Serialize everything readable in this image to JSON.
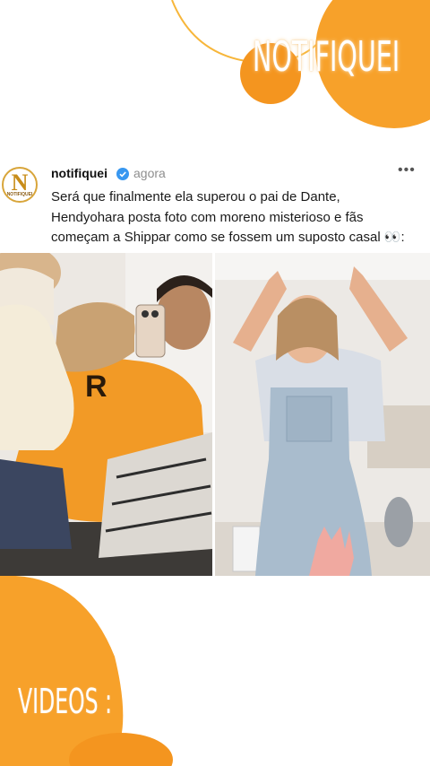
{
  "brand": {
    "name": "NOTIFIQUEI"
  },
  "post": {
    "avatar": {
      "letter": "N",
      "word": "NOTIFIQUEI"
    },
    "username": "notifiquei",
    "time": "agora",
    "more_label": "•••",
    "caption_lines": [
      "Será que finalmente ela superou o pai de Dante,",
      "Hendyohara posta foto com moreno misterioso e fãs",
      "começam a Shippar como se fossem um suposto casal 👀:"
    ]
  },
  "photos": {
    "left": {
      "shirt_text": "R"
    },
    "right": {}
  },
  "footer": {
    "videos_label": "VIDEOS :"
  },
  "colors": {
    "accent_orange": "#f7a12a",
    "accent_light": "#f9b447",
    "verified_blue": "#3897f0"
  },
  "icons": [
    "verified-icon",
    "more-options-icon"
  ]
}
